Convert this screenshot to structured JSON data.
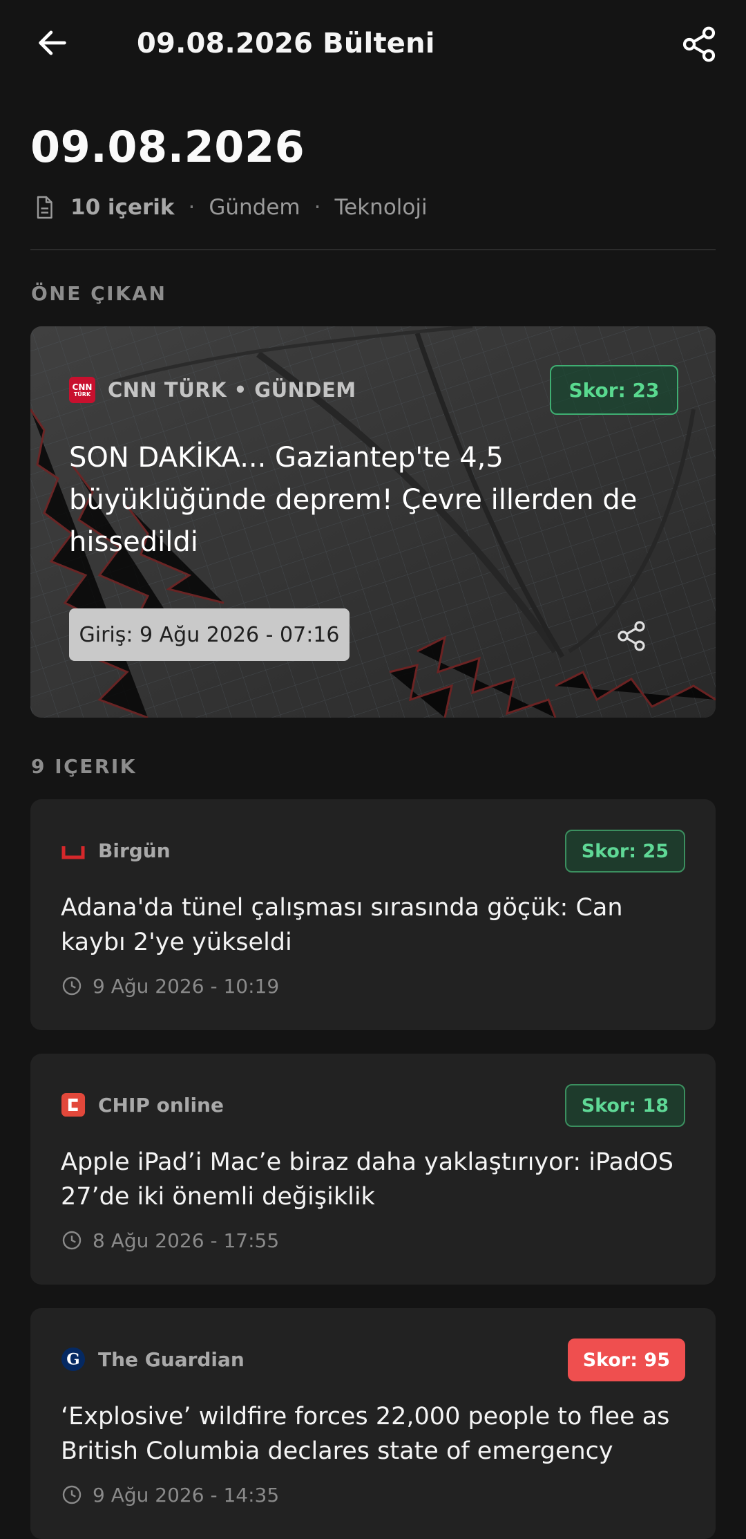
{
  "appbar": {
    "title": "09.08.2026 Bülteni",
    "back_icon": "arrow-left-icon",
    "share_icon": "share-icon"
  },
  "header": {
    "date": "09.08.2026",
    "count": "10 içerik",
    "separator": "·",
    "categories": [
      "Gündem",
      "Teknoloji"
    ]
  },
  "featured": {
    "section_label": "ÖNE ÇIKAN",
    "source": "CNN TÜRK • GÜNDEM",
    "logo_text": [
      "CNN",
      "TÜRK"
    ],
    "score": "Skor: 23",
    "title": "SON DAKİKA... Gaziantep'te 4,5 büyüklüğünde deprem! Çevre illerden de hissedildi",
    "date": "Giriş: 9 Ağu 2026 - 07:16"
  },
  "list": {
    "section_label": "9 IÇERIK",
    "items": [
      {
        "source": "Birgün",
        "score": "Skor: 25",
        "score_color": "#5fd896",
        "title": "Adana'da tünel çalışması sırasında göçük: Can kaybı 2'ye yükseldi",
        "time": "9 Ağu 2026 - 10:19"
      },
      {
        "source": "CHIP online",
        "score": "Skor: 18",
        "score_color": "#5fd896",
        "title": "Apple iPad’i Mac’e biraz daha yaklaştırıyor: iPadOS 27’de iki önemli değişiklik",
        "time": "8 Ağu 2026 - 17:55"
      },
      {
        "source": "The Guardian",
        "score": "Skor: 95",
        "score_color": "#ef4f4f",
        "title": "‘Explosive’ wildfire forces 22,000 people to flee as British Columbia declares state of emergency",
        "time": "9 Ağu 2026 - 14:35"
      }
    ]
  }
}
